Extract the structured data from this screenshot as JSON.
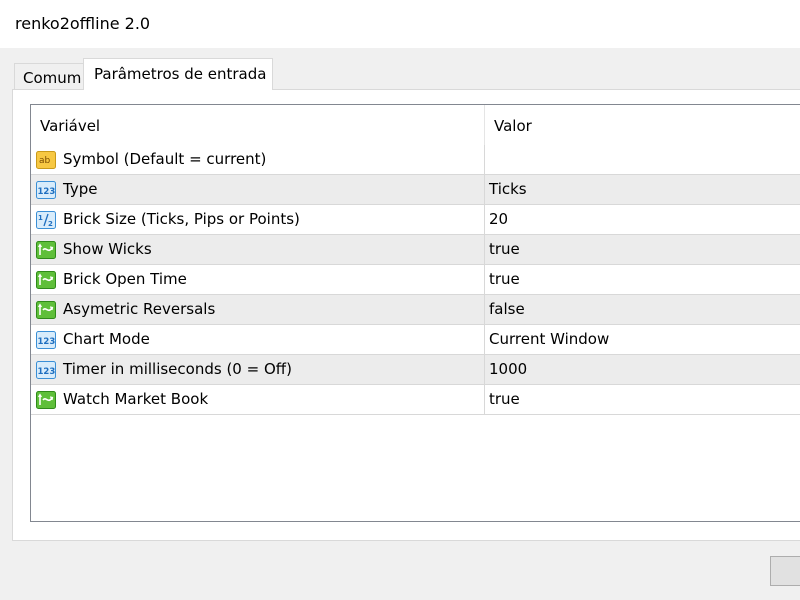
{
  "window": {
    "title": "renko2offline 2.0"
  },
  "tabs": [
    {
      "label": "Comum",
      "active": false
    },
    {
      "label": "Parâmetros de entrada",
      "active": true
    }
  ],
  "table": {
    "columns": [
      "Variável",
      "Valor"
    ],
    "rows": [
      {
        "icon": "string-type-icon",
        "name": "Symbol (Default = current)",
        "value": ""
      },
      {
        "icon": "integer-type-icon",
        "name": "Type",
        "value": "Ticks"
      },
      {
        "icon": "double-type-icon",
        "name": "Brick Size (Ticks, Pips or Points)",
        "value": "20"
      },
      {
        "icon": "boolean-type-icon",
        "name": "Show Wicks",
        "value": "true"
      },
      {
        "icon": "boolean-type-icon",
        "name": "Brick Open Time",
        "value": "true"
      },
      {
        "icon": "boolean-type-icon",
        "name": "Asymetric Reversals",
        "value": "false"
      },
      {
        "icon": "integer-type-icon",
        "name": "Chart Mode",
        "value": "Current Window"
      },
      {
        "icon": "integer-type-icon",
        "name": "Timer in milliseconds (0 = Off)",
        "value": "1000"
      },
      {
        "icon": "boolean-type-icon",
        "name": "Watch Market Book",
        "value": "true"
      }
    ]
  },
  "colors": {
    "dialog_background": "#f0f0f0",
    "row_alternate": "#ececec",
    "grid_border": "#828790"
  }
}
